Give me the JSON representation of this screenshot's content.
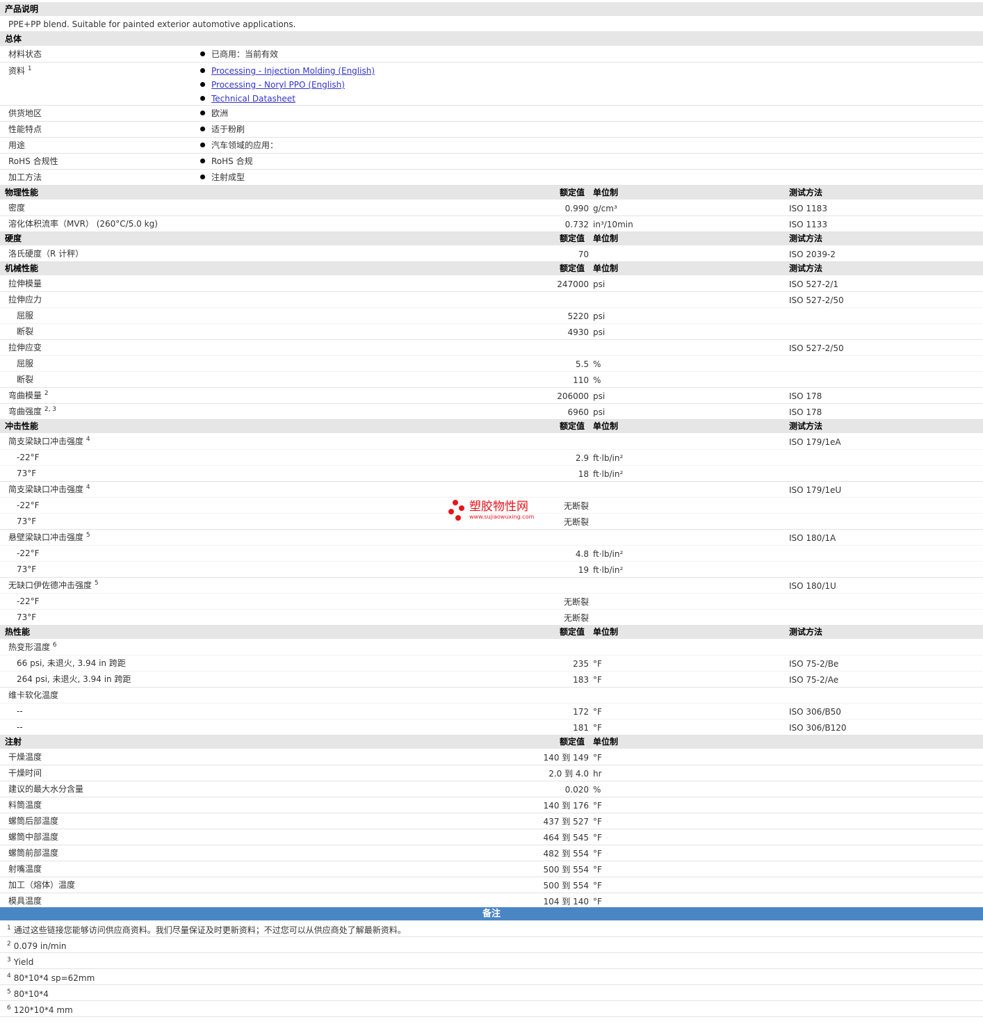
{
  "sections": {
    "desc": "产品说明",
    "general": "总体",
    "physical": "物理性能",
    "hardness": "硬度",
    "mechanical": "机械性能",
    "impact": "冲击性能",
    "thermal": "热性能",
    "injection": "注射",
    "notes": "备注"
  },
  "columns": {
    "nominal": "额定值",
    "unit": "单位制",
    "test": "测试方法"
  },
  "description": "PPE+PP blend. Suitable for painted exterior automotive applications.",
  "general": {
    "status_label": "材料状态",
    "status_value": "已商用：当前有效",
    "docs_label": "资料",
    "docs_note": "1",
    "docs": [
      "Processing - Injection Molding (English)",
      "Processing - Noryl PPO (English)",
      "Technical Datasheet"
    ],
    "region_label": "供货地区",
    "region_value": "欧洲",
    "features_label": "性能特点",
    "features_value": "适于粉刷",
    "uses_label": "用途",
    "uses_value": "汽车领域的应用：",
    "rohs_label": "RoHS 合规性",
    "rohs_value": "RoHS 合规",
    "method_label": "加工方法",
    "method_value": "注射成型"
  },
  "rows": {
    "density": {
      "label": "密度",
      "value": "0.990",
      "unit": "g/cm³",
      "test": "ISO 1183"
    },
    "mvr": {
      "label": "溶化体积流率（MVR） (260°C/5.0 kg)",
      "value": "0.732",
      "unit": "in³/10min",
      "test": "ISO 1133"
    },
    "rockwell": {
      "label": "洛氏硬度（R 计秤）",
      "value": "70",
      "unit": "",
      "test": "ISO 2039-2"
    },
    "tensile_modulus": {
      "label": "拉伸模量",
      "value": "247000",
      "unit": "psi",
      "test": "ISO 527-2/1"
    },
    "tensile_stress": {
      "label": "拉伸应力",
      "value": "",
      "unit": "",
      "test": "ISO 527-2/50"
    },
    "ts_yield": {
      "label": "屈服",
      "value": "5220",
      "unit": "psi",
      "test": ""
    },
    "ts_break": {
      "label": "断裂",
      "value": "4930",
      "unit": "psi",
      "test": ""
    },
    "tensile_strain": {
      "label": "拉伸应变",
      "value": "",
      "unit": "",
      "test": "ISO 527-2/50"
    },
    "tst_yield": {
      "label": "屈服",
      "value": "5.5",
      "unit": "%",
      "test": ""
    },
    "tst_break": {
      "label": "断裂",
      "value": "110",
      "unit": "%",
      "test": ""
    },
    "flex_modulus": {
      "label": "弯曲模量",
      "sup": "2",
      "value": "206000",
      "unit": "psi",
      "test": "ISO 178"
    },
    "flex_strength": {
      "label": "弯曲强度",
      "sup": "2, 3",
      "value": "6960",
      "unit": "psi",
      "test": "ISO 178"
    },
    "charpy_n": {
      "label": "简支梁缺口冲击强度",
      "sup": "4",
      "value": "",
      "unit": "",
      "test": "ISO 179/1eA"
    },
    "charpy_n_1": {
      "label": "-22°F",
      "value": "2.9",
      "unit": "ft·lb/in²",
      "test": ""
    },
    "charpy_n_2": {
      "label": "73°F",
      "value": "18",
      "unit": "ft·lb/in²",
      "test": ""
    },
    "charpy_u": {
      "label": "简支梁缺口冲击强度",
      "sup": "4",
      "value": "",
      "unit": "",
      "test": "ISO 179/1eU"
    },
    "charpy_u_1": {
      "label": "-22°F",
      "value": "无断裂",
      "unit": "",
      "test": ""
    },
    "charpy_u_2": {
      "label": "73°F",
      "value": "无断裂",
      "unit": "",
      "test": ""
    },
    "izod_n": {
      "label": "悬壁梁缺口冲击强度",
      "sup": "5",
      "value": "",
      "unit": "",
      "test": "ISO 180/1A"
    },
    "izod_n_1": {
      "label": "-22°F",
      "value": "4.8",
      "unit": "ft·lb/in²",
      "test": ""
    },
    "izod_n_2": {
      "label": "73°F",
      "value": "19",
      "unit": "ft·lb/in²",
      "test": ""
    },
    "izod_u": {
      "label": "无缺口伊佐德冲击强度",
      "sup": "5",
      "value": "",
      "unit": "",
      "test": "ISO 180/1U"
    },
    "izod_u_1": {
      "label": "-22°F",
      "value": "无断裂",
      "unit": "",
      "test": ""
    },
    "izod_u_2": {
      "label": "73°F",
      "value": "无断裂",
      "unit": "",
      "test": ""
    },
    "hdt": {
      "label": "热变形温度",
      "sup": "6",
      "value": "",
      "unit": "",
      "test": ""
    },
    "hdt_1": {
      "label": "66 psi, 未退火, 3.94 in 跨距",
      "value": "235",
      "unit": "°F",
      "test": "ISO 75-2/Be"
    },
    "hdt_2": {
      "label": "264 psi, 未退火, 3.94 in 跨距",
      "value": "183",
      "unit": "°F",
      "test": "ISO 75-2/Ae"
    },
    "vicat": {
      "label": "维卡软化温度",
      "value": "",
      "unit": "",
      "test": ""
    },
    "vicat_1": {
      "label": "--",
      "value": "172",
      "unit": "°F",
      "test": "ISO 306/B50"
    },
    "vicat_2": {
      "label": "--",
      "value": "181",
      "unit": "°F",
      "test": "ISO 306/B120"
    },
    "dry_temp": {
      "label": "干燥温度",
      "value": "140 到 149",
      "unit": "°F",
      "test": ""
    },
    "dry_time": {
      "label": "干燥时间",
      "value": "2.0 到 4.0",
      "unit": "hr",
      "test": ""
    },
    "moisture": {
      "label": "建议的最大水分含量",
      "value": "0.020",
      "unit": "%",
      "test": ""
    },
    "hopper": {
      "label": "料筒温度",
      "value": "140 到 176",
      "unit": "°F",
      "test": ""
    },
    "rear": {
      "label": "螺筒后部温度",
      "value": "437 到 527",
      "unit": "°F",
      "test": ""
    },
    "middle": {
      "label": "螺筒中部温度",
      "value": "464 到 545",
      "unit": "°F",
      "test": ""
    },
    "front": {
      "label": "螺筒前部温度",
      "value": "482 到 554",
      "unit": "°F",
      "test": ""
    },
    "nozzle": {
      "label": "射嘴温度",
      "value": "500 到 554",
      "unit": "°F",
      "test": ""
    },
    "melt": {
      "label": "加工（熔体）温度",
      "value": "500 到 554",
      "unit": "°F",
      "test": ""
    },
    "mold": {
      "label": "模具温度",
      "value": "104 到 140",
      "unit": "°F",
      "test": ""
    }
  },
  "notes": [
    {
      "n": "1",
      "text": "通过这些链接您能够访问供应商资料。我们尽量保证及时更新资料；不过您可以从供应商处了解最新资料。"
    },
    {
      "n": "2",
      "text": "0.079 in/min"
    },
    {
      "n": "3",
      "text": "Yield"
    },
    {
      "n": "4",
      "text": "80*10*4 sp=62mm"
    },
    {
      "n": "5",
      "text": "80*10*4"
    },
    {
      "n": "6",
      "text": "120*10*4 mm"
    }
  ],
  "watermark": {
    "title": "塑胶物性网",
    "url": "www.sujiaowuxing.com"
  }
}
